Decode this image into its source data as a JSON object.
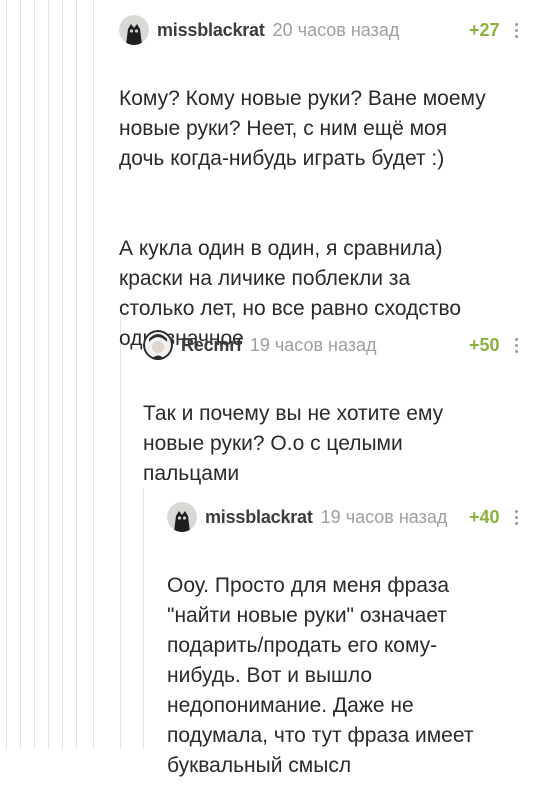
{
  "comments": [
    {
      "username": "missblackrat",
      "time": "20 часов назад",
      "rating": "+27",
      "avatar_icon": "cat-avatar-icon",
      "paragraphs": [
        "Кому? Кому новые руки? Ване моему\nновые руки? Неет, с ним ещё моя\nдочь когда-нибудь играть будет :)",
        "А кукла один в один, я сравнила)\nкраски на личике поблекли за\nстолько лет, но все равно сходство\nоднозначное"
      ]
    },
    {
      "username": "Recmrf",
      "time": "19 часов назад",
      "rating": "+50",
      "avatar_icon": "user-avatar-icon",
      "paragraphs": [
        "Так и почему вы не хотите ему\nновые руки? О.о с целыми\nпальцами"
      ]
    },
    {
      "username": "missblackrat",
      "time": "19 часов назад",
      "rating": "+40",
      "avatar_icon": "cat-avatar-icon",
      "paragraphs": [
        "Ооу. Просто для меня фраза\n\"найти новые руки\" означает\nподарить/продать его кому-\nнибудь. Вот и вышло\nнедопонимание. Даже не\nподумала, что тут фраза имеет\nбуквальный смысл"
      ]
    }
  ],
  "colors": {
    "rating": "#8ab13e",
    "username": "#3b3b3b",
    "timestamp": "#9e9e9e",
    "thread_line": "#e4e4e4"
  }
}
